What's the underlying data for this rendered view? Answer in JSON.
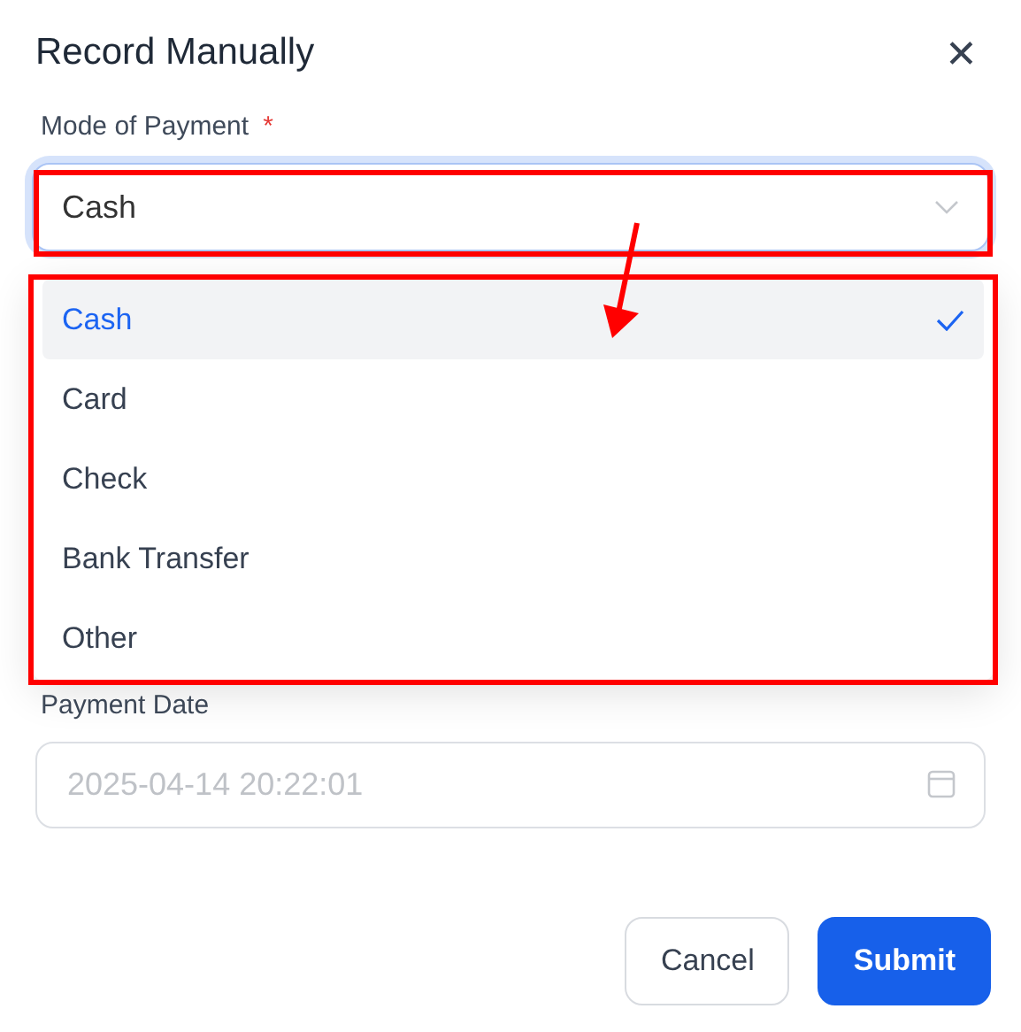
{
  "dialog": {
    "title": "Record Manually",
    "close": "✕"
  },
  "payment_mode": {
    "label": "Mode of Payment",
    "required_mark": "*",
    "value": "Cash",
    "expanded": true,
    "options": [
      {
        "label": "Cash",
        "selected": true
      },
      {
        "label": "Card",
        "selected": false
      },
      {
        "label": "Check",
        "selected": false
      },
      {
        "label": "Bank Transfer",
        "selected": false
      },
      {
        "label": "Other",
        "selected": false
      }
    ]
  },
  "payment_date": {
    "label": "Payment Date",
    "placeholder": "2025-04-14 20:22:01"
  },
  "buttons": [
    {
      "label": "Cancel",
      "kind": "secondary"
    },
    {
      "label": "Submit",
      "kind": "primary"
    }
  ]
}
